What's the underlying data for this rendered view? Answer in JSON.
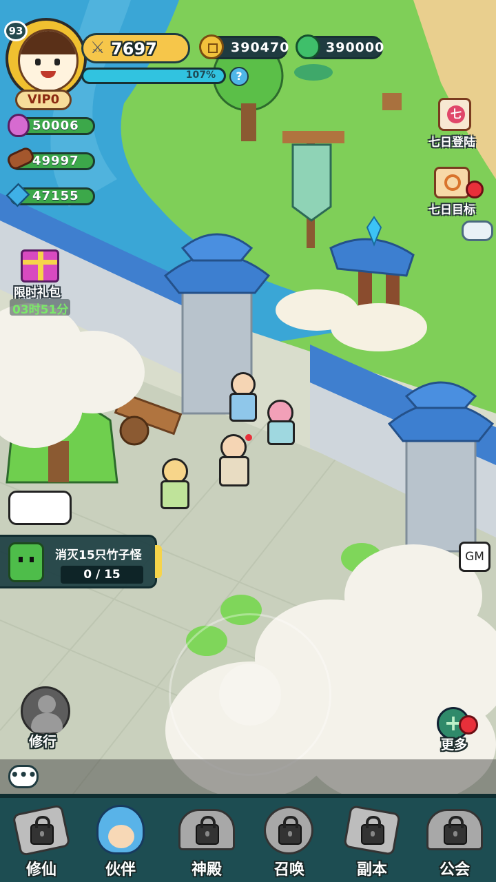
{
  "player": {
    "level": "93",
    "vip": "VIP0",
    "power": "7697",
    "exp_percent": "107%",
    "exp_fraction": 1.0,
    "help_icon": "question-icon"
  },
  "currencies": {
    "coins": "390470",
    "jade": "390000"
  },
  "resources": [
    {
      "name": "spirit-flame",
      "value": "50006",
      "icon_color": "#d66bd0"
    },
    {
      "name": "wood",
      "value": "49997",
      "icon_color": "#a4572d"
    },
    {
      "name": "crystal",
      "value": "47155",
      "icon_color": "#3fb0e6"
    }
  ],
  "events": {
    "limited_gift_label": "限时礼包",
    "limited_gift_timer": "03时51分",
    "seven_day_login": "七日登陆",
    "seven_day_goal": "七日目标"
  },
  "quest": {
    "title": "消灭15只竹子怪",
    "progress": "0 / 15",
    "current": 0,
    "target": 15
  },
  "buttons": {
    "gm": "GM",
    "more": "更多",
    "cultivate": "修行"
  },
  "nav": [
    {
      "label": "修仙",
      "locked": true
    },
    {
      "label": "伙伴",
      "locked": false
    },
    {
      "label": "神殿",
      "locked": true
    },
    {
      "label": "召唤",
      "locked": true
    },
    {
      "label": "副本",
      "locked": true
    },
    {
      "label": "公会",
      "locked": true
    }
  ],
  "colors": {
    "grass": "#7fcf58",
    "water": "#3aa6d6",
    "roof_blue": "#3d7fd0",
    "nav_bg": "#1d4d52",
    "exp_bar": "#31c3e0",
    "alert_red": "#e8303a"
  }
}
